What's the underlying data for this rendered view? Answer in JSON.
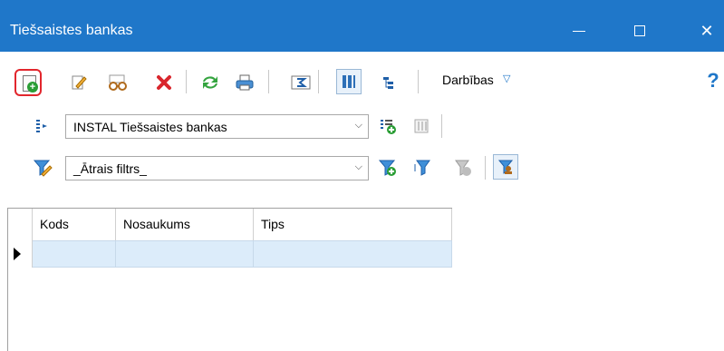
{
  "window": {
    "title": "Tiešsaistes bankas",
    "titlebar_color": "#1f77c9",
    "minimize_icon": "minimize-icon",
    "maximize_icon": "maximize-icon",
    "close_icon": "close-icon",
    "close_glyph": "✕"
  },
  "toolbar": {
    "actions_label": "Darbības",
    "dropdown_glyph": "▽",
    "help_glyph": "?",
    "icons": [
      "new-record-icon",
      "edit-icon",
      "view-glasses-icon",
      "delete-icon",
      "refresh-icon",
      "print-icon",
      "sum-icon",
      "columns-icon",
      "tree-icon",
      "help-icon"
    ]
  },
  "bank_selector": {
    "value": "INSTAL Tiešsaistes bankas"
  },
  "filter": {
    "value": "_Ātrais filtrs_"
  },
  "grid": {
    "columns": [
      "Kods",
      "Nosaukums",
      "Tips"
    ],
    "selected_row_color": "#dcecfa"
  }
}
